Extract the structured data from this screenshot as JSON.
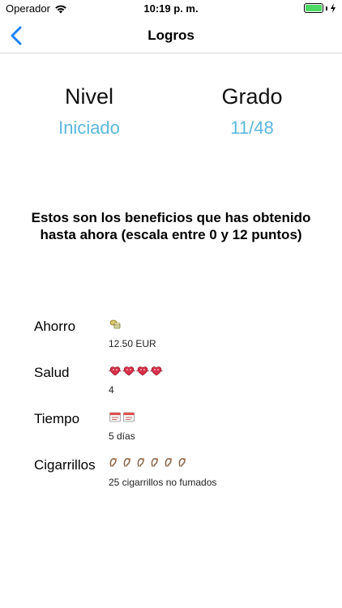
{
  "status_bar": {
    "carrier": "Operador",
    "time": "10:19 p. m."
  },
  "nav": {
    "title": "Logros"
  },
  "stats": {
    "level_label": "Nivel",
    "level_value": "Iniciado",
    "grade_label": "Grado",
    "grade_value": "11/48"
  },
  "benefits_title": "Estos son los beneficios que has obtenido hasta ahora (escala entre 0 y 12 puntos)",
  "rows": [
    {
      "label": "Ahorro",
      "icon": "coins-icon",
      "icon_count": 1,
      "value": "12.50 EUR"
    },
    {
      "label": "Salud",
      "icon": "heart-icon",
      "icon_count": 4,
      "value": "4"
    },
    {
      "label": "Tiempo",
      "icon": "calendar-icon",
      "icon_count": 2,
      "value": "5 días"
    },
    {
      "label": "Cigarrillos",
      "icon": "cigarette-icon",
      "icon_count": 6,
      "value": "25 cigarrillos no fumados"
    }
  ],
  "colors": {
    "accent_blue": "#1a82fb",
    "stat_value": "#5bb8db",
    "battery": "#4cd964"
  }
}
